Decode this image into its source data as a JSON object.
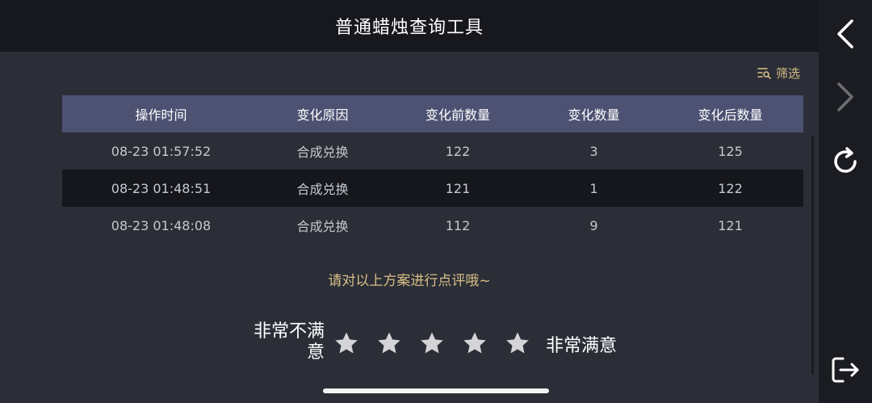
{
  "header": {
    "title": "普通蜡烛查询工具"
  },
  "filter": {
    "label": "筛选",
    "icon": "filter-search-icon"
  },
  "table": {
    "columns": [
      "操作时间",
      "变化原因",
      "变化前数量",
      "变化数量",
      "变化后数量"
    ],
    "rows": [
      [
        "08-23 01:57:52",
        "合成兑换",
        "122",
        "3",
        "125"
      ],
      [
        "08-23 01:48:51",
        "合成兑换",
        "121",
        "1",
        "122"
      ],
      [
        "08-23 01:48:08",
        "合成兑换",
        "112",
        "9",
        "121"
      ]
    ]
  },
  "rating": {
    "prompt": "请对以上方案进行点评哦~",
    "low_label_line1": "非常不满",
    "low_label_line2": "意",
    "high_label": "非常满意",
    "star_count": 5,
    "selected": 0
  },
  "side_nav": [
    "back-icon",
    "forward-icon",
    "refresh-icon",
    "exit-icon"
  ],
  "colors": {
    "accent": "#d9bf88",
    "header_bg": "#17181d",
    "table_header": "#4d5172",
    "star": "#d4d4d6"
  }
}
